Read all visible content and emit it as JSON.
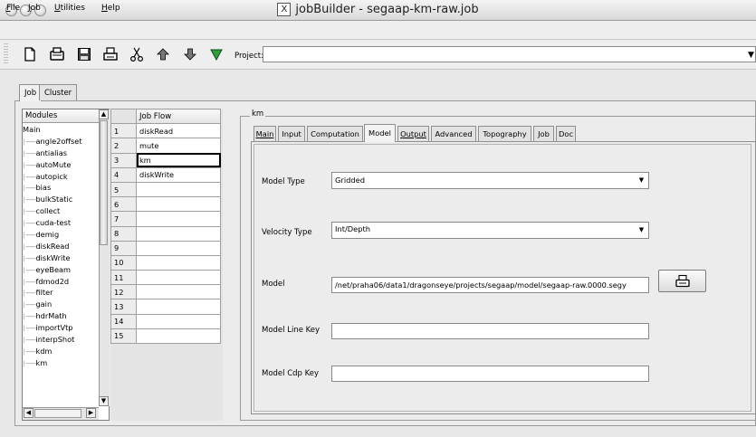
{
  "window": {
    "title": "jobBuilder - segaap-km-raw.job"
  },
  "menu": [
    {
      "label": "File",
      "mnemonic": "F",
      "rest": "ile"
    },
    {
      "label": "Job",
      "mnemonic": "J",
      "rest": "ob"
    },
    {
      "label": "Utilities",
      "mnemonic": "U",
      "rest": "tilities"
    },
    {
      "label": "Help",
      "mnemonic": "H",
      "rest": "elp"
    }
  ],
  "toolbar": {
    "icons": [
      "new-document-icon",
      "open-icon",
      "save-icon",
      "print-icon",
      "cut-icon",
      "move-up-icon",
      "move-down-icon",
      "filter-icon"
    ],
    "project_label": "Project:",
    "project_value": ""
  },
  "outer_tabs": [
    "Job",
    "Cluster"
  ],
  "modules": {
    "header": "Modules",
    "items": [
      "Main",
      "angle2offset",
      "antialias",
      "autoMute",
      "autopick",
      "bias",
      "bulkStatic",
      "collect",
      "cuda-test",
      "demig",
      "diskRead",
      "diskWrite",
      "eyeBeam",
      "fdmod2d",
      "filter",
      "gain",
      "hdrMath",
      "importVtp",
      "interpShot",
      "kdm",
      "km"
    ]
  },
  "jobflow": {
    "header": "Job Flow",
    "rows": [
      {
        "n": "1",
        "v": "diskRead"
      },
      {
        "n": "2",
        "v": "mute"
      },
      {
        "n": "3",
        "v": "km"
      },
      {
        "n": "4",
        "v": "diskWrite"
      },
      {
        "n": "5",
        "v": ""
      },
      {
        "n": "6",
        "v": ""
      },
      {
        "n": "7",
        "v": ""
      },
      {
        "n": "8",
        "v": ""
      },
      {
        "n": "9",
        "v": ""
      },
      {
        "n": "10",
        "v": ""
      },
      {
        "n": "11",
        "v": ""
      },
      {
        "n": "12",
        "v": ""
      },
      {
        "n": "13",
        "v": ""
      },
      {
        "n": "14",
        "v": ""
      },
      {
        "n": "15",
        "v": ""
      }
    ]
  },
  "km": {
    "group_title": "km",
    "tabs": [
      "Main",
      "Input",
      "Computation",
      "Model",
      "Output",
      "Advanced",
      "Topography",
      "Job",
      "Doc"
    ],
    "active_tab": "Model",
    "fields": {
      "model_type": {
        "label": "Model Type",
        "value": "Gridded"
      },
      "velocity_type": {
        "label": "Velocity Type",
        "value": "Int/Depth"
      },
      "model": {
        "label": "Model",
        "value": "/net/praha06/data1/dragonseye/projects/segaap/model/segaap-raw.0000.segy"
      },
      "model_line_key": {
        "label": "Model Line Key",
        "value": ""
      },
      "model_cdp_key": {
        "label": "Model Cdp Key",
        "value": ""
      }
    }
  }
}
